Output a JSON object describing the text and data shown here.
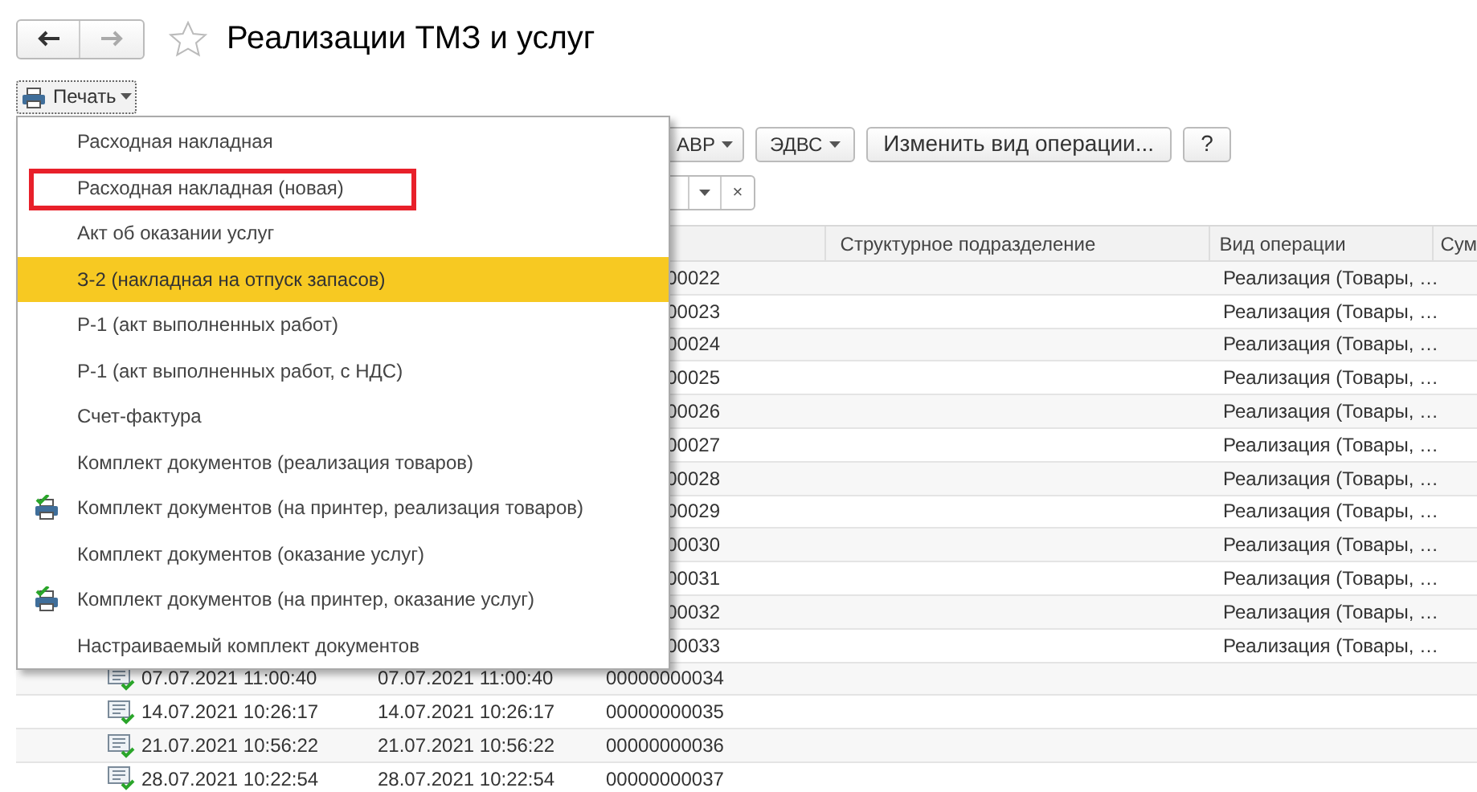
{
  "window": {
    "title": "Реализации ТМЗ и услуг",
    "favorite": false
  },
  "print_button": {
    "label": "Печать"
  },
  "toolbar": [
    {
      "label": "АВР",
      "dropdown": true
    },
    {
      "label": "ЭДВС",
      "dropdown": true
    },
    {
      "label": "Изменить вид операции...",
      "dropdown": false
    },
    {
      "label": "?",
      "dropdown": false
    }
  ],
  "filter": {
    "clear": "×"
  },
  "print_menu": [
    {
      "label": "Расходная накладная",
      "selected": false,
      "outlined": false,
      "printer_icon": false
    },
    {
      "label": "Расходная накладная (новая)",
      "selected": false,
      "outlined": true,
      "printer_icon": false
    },
    {
      "label": "Акт об оказании услуг",
      "selected": false,
      "outlined": false,
      "printer_icon": false
    },
    {
      "label": "З-2 (накладная на отпуск запасов)",
      "selected": true,
      "outlined": false,
      "printer_icon": false
    },
    {
      "label": "Р-1 (акт выполненных работ)",
      "selected": false,
      "outlined": false,
      "printer_icon": false
    },
    {
      "label": "Р-1 (акт выполненных работ, с НДС)",
      "selected": false,
      "outlined": false,
      "printer_icon": false
    },
    {
      "label": "Счет-фактура",
      "selected": false,
      "outlined": false,
      "printer_icon": false
    },
    {
      "label": "Комплект документов (реализация товаров)",
      "selected": false,
      "outlined": false,
      "printer_icon": false
    },
    {
      "label": "Комплект документов (на принтер, реализация товаров)",
      "selected": false,
      "outlined": false,
      "printer_icon": true
    },
    {
      "label": "Комплект документов (оказание услуг)",
      "selected": false,
      "outlined": false,
      "printer_icon": false
    },
    {
      "label": "Комплект документов (на принтер, оказание услуг)",
      "selected": false,
      "outlined": false,
      "printer_icon": true
    },
    {
      "label": "Настраиваемый комплект документов",
      "selected": false,
      "outlined": false,
      "printer_icon": false
    }
  ],
  "table": {
    "columns": [
      "Структурное подразделение",
      "Вид операции",
      "Сум"
    ],
    "rows": [
      {
        "column_3": "00022",
        "operation": "Реализация (Товары, …"
      },
      {
        "column_3": "00023",
        "operation": "Реализация (Товары, …"
      },
      {
        "column_3": "00024",
        "operation": "Реализация (Товары, …"
      },
      {
        "column_3": "00025",
        "operation": "Реализация (Товары, …"
      },
      {
        "column_3": "00026",
        "operation": "Реализация (Товары, …"
      },
      {
        "column_3": "00027",
        "operation": "Реализация (Товары, …"
      },
      {
        "column_3": "00028",
        "operation": "Реализация (Товары, …"
      },
      {
        "column_3": "00029",
        "operation": "Реализация (Товары, …"
      },
      {
        "column_3": "00030",
        "operation": "Реализация (Товары, …"
      },
      {
        "column_3": "00031",
        "operation": "Реализация (Товары, …"
      },
      {
        "column_3": "00032",
        "operation": "Реализация (Товары, …"
      },
      {
        "column_3": "00033",
        "operation": "Реализация (Товары, …"
      },
      {
        "column_1": "07.07.2021 11:00:40",
        "column_2": "07.07.2021 11:00:40",
        "column_3": "00000000034"
      },
      {
        "column_1": "14.07.2021 10:26:17",
        "column_2": "14.07.2021 10:26:17",
        "column_3": "00000000035"
      },
      {
        "column_1": "21.07.2021 10:56:22",
        "column_2": "21.07.2021 10:56:22",
        "column_3": "00000000036"
      },
      {
        "column_1": "28.07.2021 10:22:54",
        "column_2": "28.07.2021 10:22:54",
        "column_3": "00000000037"
      }
    ]
  }
}
